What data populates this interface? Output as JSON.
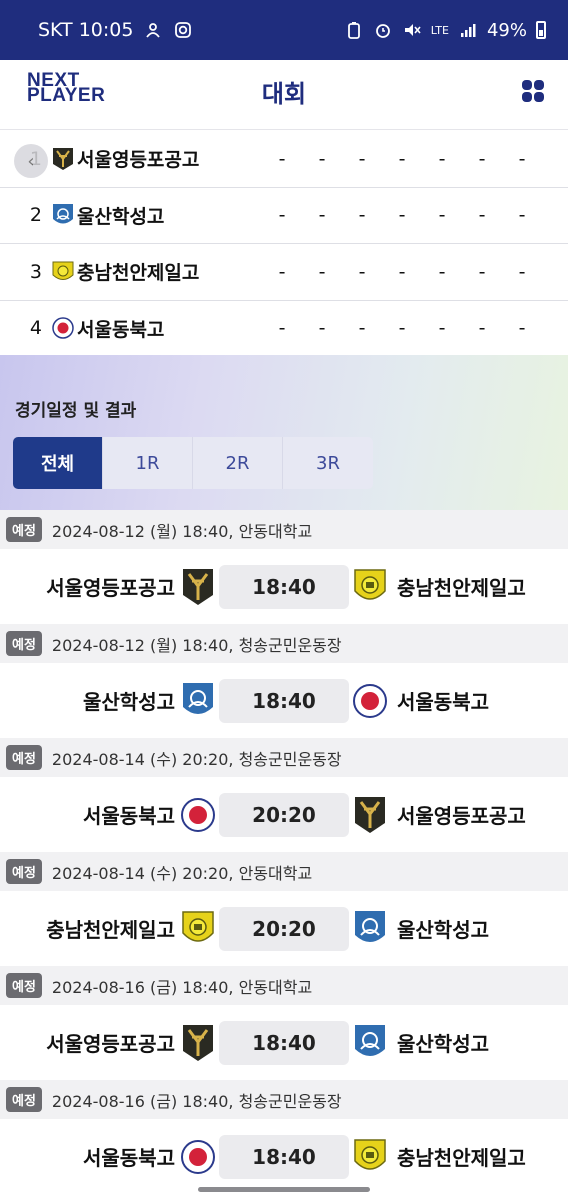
{
  "status": {
    "carrier_time": "SKT 10:05",
    "network": "LTE",
    "battery": "49%"
  },
  "header": {
    "logo_line1": "NEXT",
    "logo_line2": "PLAYER",
    "title": "대회"
  },
  "standings": [
    {
      "rank": "1",
      "team": "서울영등포공고",
      "emblem": "yeongdeungpo-emblem",
      "stats": [
        "-",
        "-",
        "-",
        "-",
        "-",
        "-",
        "-"
      ]
    },
    {
      "rank": "2",
      "team": "울산학성고",
      "emblem": "hakseong-emblem",
      "stats": [
        "-",
        "-",
        "-",
        "-",
        "-",
        "-",
        "-"
      ]
    },
    {
      "rank": "3",
      "team": "충남천안제일고",
      "emblem": "cheonan-emblem",
      "stats": [
        "-",
        "-",
        "-",
        "-",
        "-",
        "-",
        "-"
      ]
    },
    {
      "rank": "4",
      "team": "서울동북고",
      "emblem": "dongbuk-emblem",
      "stats": [
        "-",
        "-",
        "-",
        "-",
        "-",
        "-",
        "-"
      ]
    }
  ],
  "schedule": {
    "title": "경기일정 및 결과",
    "tabs": [
      "전체",
      "1R",
      "2R",
      "3R"
    ],
    "active_tab": "전체"
  },
  "matches": [
    {
      "status": "예정",
      "info": "2024-08-12 (월) 18:40, 안동대학교",
      "home": "서울영등포공고",
      "home_emblem": "yeongdeungpo-emblem",
      "time": "18:40",
      "away": "충남천안제일고",
      "away_emblem": "cheonan-emblem"
    },
    {
      "status": "예정",
      "info": "2024-08-12 (월) 18:40, 청송군민운동장",
      "home": "울산학성고",
      "home_emblem": "hakseong-emblem",
      "time": "18:40",
      "away": "서울동북고",
      "away_emblem": "dongbuk-emblem"
    },
    {
      "status": "예정",
      "info": "2024-08-14 (수) 20:20, 청송군민운동장",
      "home": "서울동북고",
      "home_emblem": "dongbuk-emblem",
      "time": "20:20",
      "away": "서울영등포공고",
      "away_emblem": "yeongdeungpo-emblem"
    },
    {
      "status": "예정",
      "info": "2024-08-14 (수) 20:20, 안동대학교",
      "home": "충남천안제일고",
      "home_emblem": "cheonan-emblem",
      "time": "20:20",
      "away": "울산학성고",
      "away_emblem": "hakseong-emblem"
    },
    {
      "status": "예정",
      "info": "2024-08-16 (금) 18:40, 안동대학교",
      "home": "서울영등포공고",
      "home_emblem": "yeongdeungpo-emblem",
      "time": "18:40",
      "away": "울산학성고",
      "away_emblem": "hakseong-emblem"
    },
    {
      "status": "예정",
      "info": "2024-08-16 (금) 18:40, 청송군민운동장",
      "home": "서울동북고",
      "home_emblem": "dongbuk-emblem",
      "time": "18:40",
      "away": "충남천안제일고",
      "away_emblem": "cheonan-emblem"
    }
  ],
  "colors": {
    "brand": "#1f2d7e",
    "active_tab": "#1f3a8a",
    "badge": "#6b6b70"
  }
}
